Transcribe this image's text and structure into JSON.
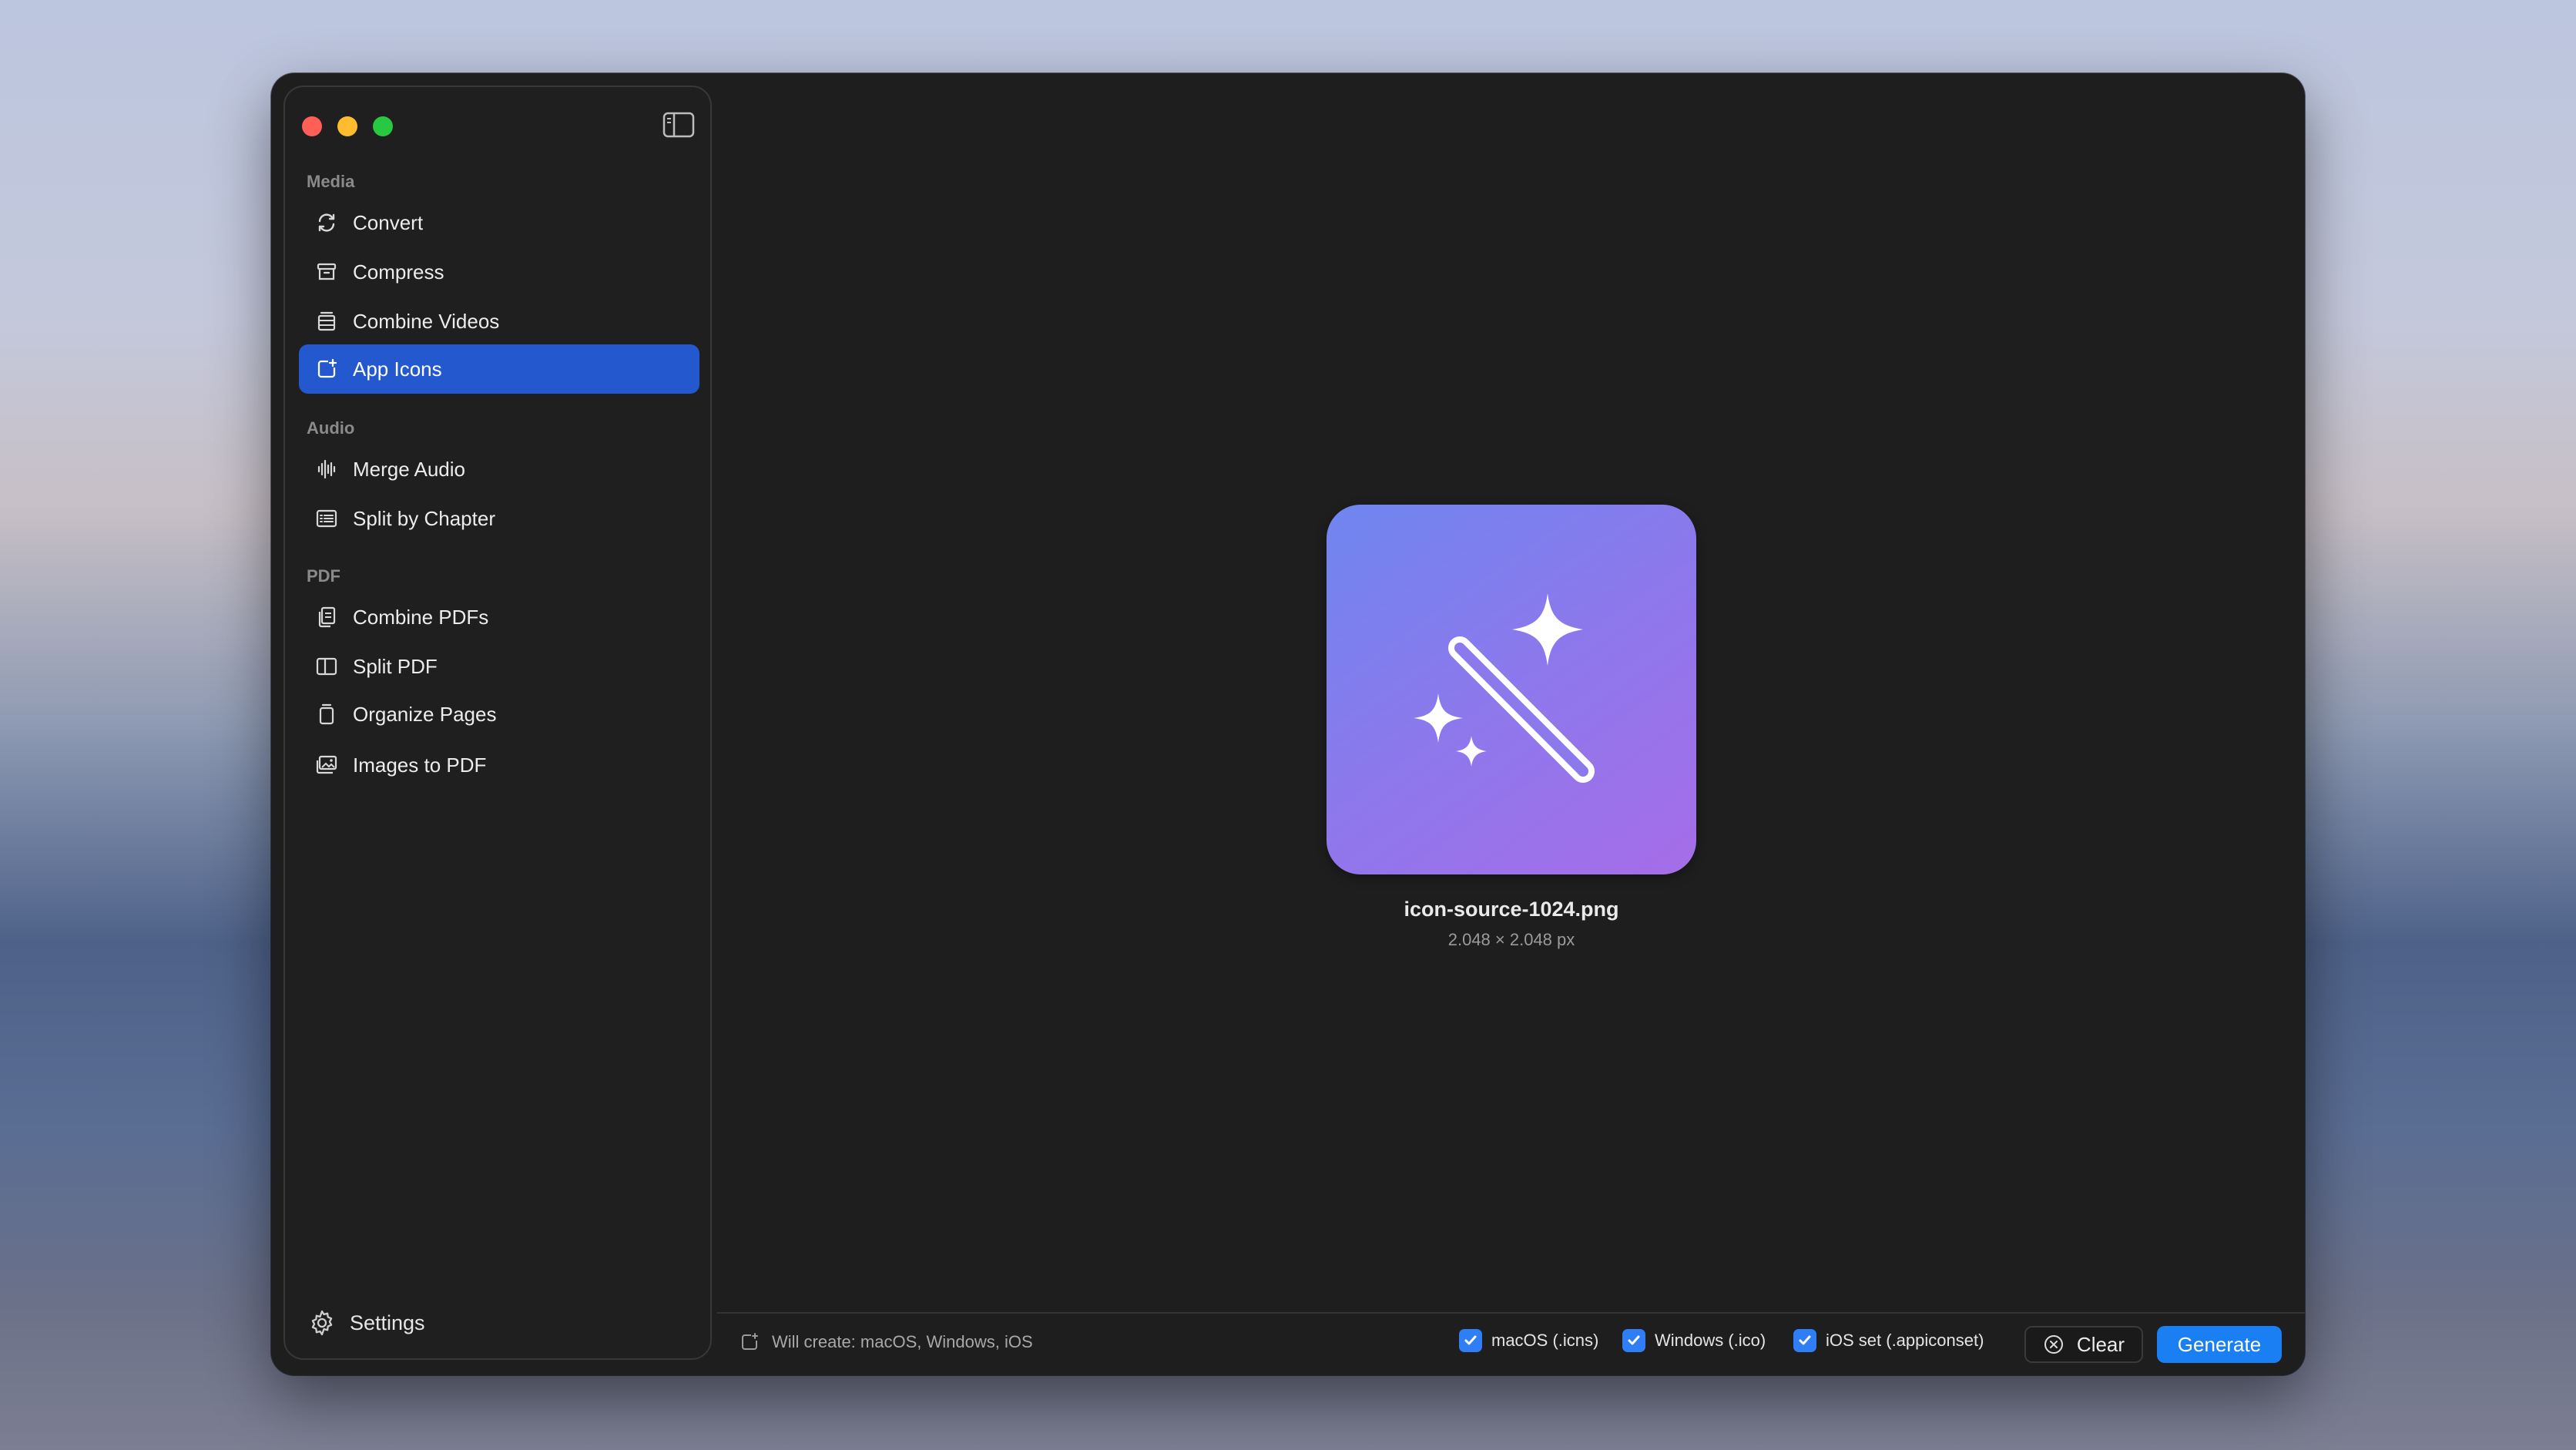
{
  "sidebar": {
    "sections": [
      {
        "label": "Media",
        "items": [
          {
            "label": "Convert",
            "icon": "convert-icon"
          },
          {
            "label": "Compress",
            "icon": "archive-box-icon"
          },
          {
            "label": "Combine Videos",
            "icon": "film-stack-icon"
          },
          {
            "label": "App Icons",
            "icon": "app-icon-badge-icon",
            "active": true
          }
        ]
      },
      {
        "label": "Audio",
        "items": [
          {
            "label": "Merge Audio",
            "icon": "waveform-icon"
          },
          {
            "label": "Split by Chapter",
            "icon": "chapter-list-icon"
          }
        ]
      },
      {
        "label": "PDF",
        "items": [
          {
            "label": "Combine PDFs",
            "icon": "documents-stack-icon"
          },
          {
            "label": "Split PDF",
            "icon": "split-pages-icon"
          },
          {
            "label": "Organize Pages",
            "icon": "page-stack-icon"
          },
          {
            "label": "Images to PDF",
            "icon": "photos-icon"
          }
        ]
      }
    ],
    "settings_label": "Settings"
  },
  "preview": {
    "filename": "icon-source-1024.png",
    "dimensions": "2.048 × 2.048 px",
    "icon": "magic-wand-sparkles-icon",
    "gradient": [
      "#6f86f0",
      "#a66de8"
    ]
  },
  "footer": {
    "will_create": "Will create: macOS, Windows, iOS",
    "options": [
      {
        "label": "macOS (.icns)",
        "checked": true
      },
      {
        "label": "Windows (.ico)",
        "checked": true
      },
      {
        "label": "iOS set (.appiconset)",
        "checked": true
      }
    ],
    "clear_label": "Clear",
    "generate_label": "Generate"
  },
  "colors": {
    "accent": "#2458cf",
    "button_primary": "#1a7ff2",
    "checkbox": "#2f7ef5",
    "window_bg": "#1e1e1e"
  }
}
